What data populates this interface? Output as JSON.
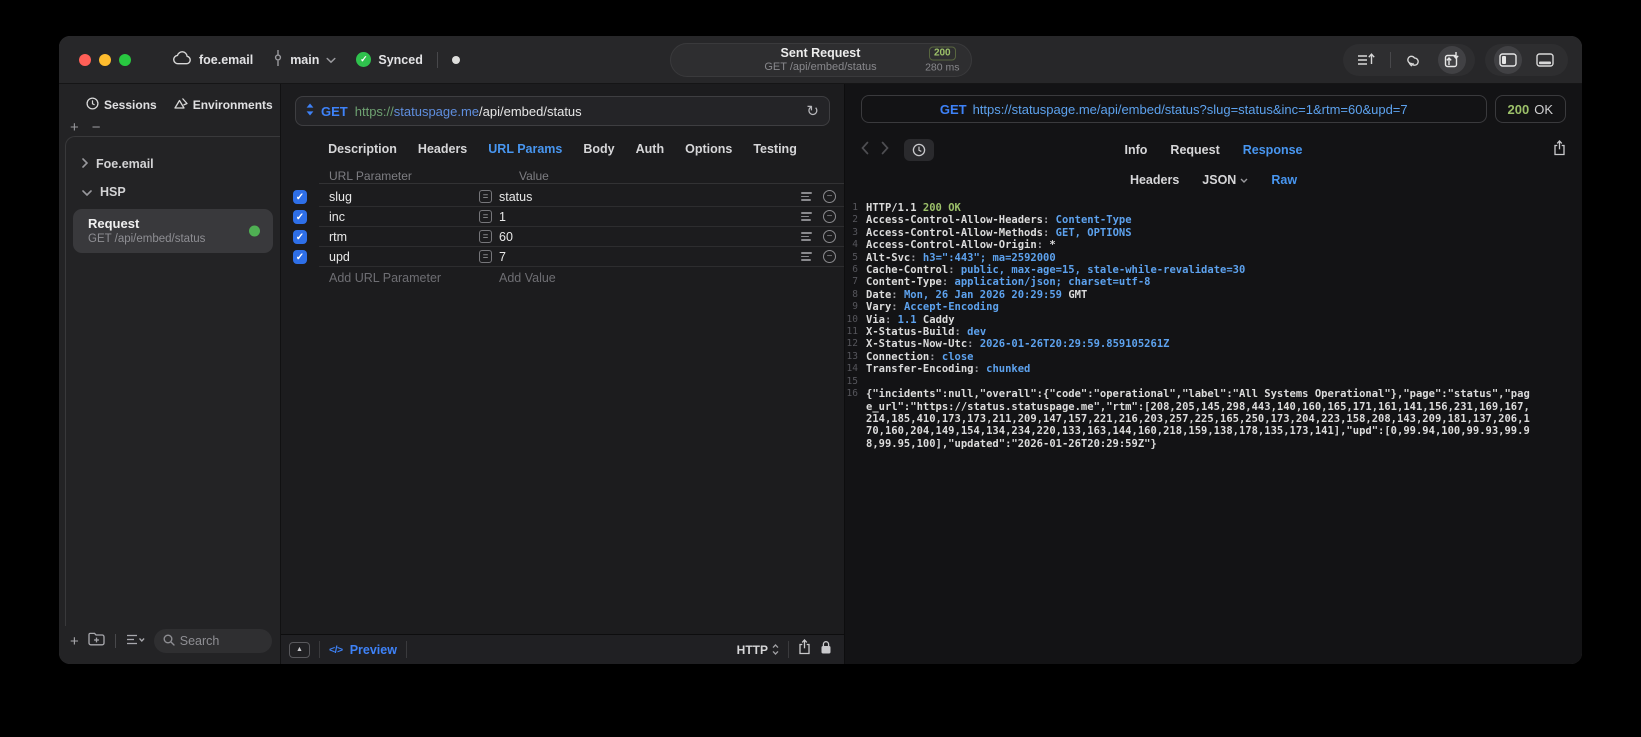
{
  "colors": {
    "accent_blue": "#4896f0",
    "method_blue": "#3e82f8",
    "status_green": "#9cc069",
    "synced_green": "#2fc24d",
    "checkbox_blue": "#2e6fe8",
    "request_dot_green": "#4fb053"
  },
  "titlebar": {
    "project": "foe.email",
    "branch": "main",
    "sync_label": "Synced",
    "center": {
      "title": "Sent Request",
      "subtitle": "GET /api/embed/status",
      "status_code": "200",
      "duration": "280 ms"
    }
  },
  "sidebar": {
    "tabs": [
      {
        "label": "Sessions",
        "icon": "clock-icon"
      },
      {
        "label": "Environments",
        "icon": "environments-icon"
      }
    ],
    "tree": [
      {
        "label": "Foe.email",
        "state": "collapsed"
      },
      {
        "label": "HSP",
        "state": "expanded"
      }
    ],
    "request_item": {
      "title": "Request",
      "subtitle": "GET /api/embed/status",
      "status": "success"
    },
    "search_placeholder": "Search"
  },
  "request_panel": {
    "method": "GET",
    "url": {
      "scheme": "https://",
      "host": "statuspage.me",
      "path": "/api/embed/status"
    },
    "tabs": [
      {
        "label": "Description"
      },
      {
        "label": "Headers"
      },
      {
        "label": "URL Params",
        "active": true
      },
      {
        "label": "Body"
      },
      {
        "label": "Auth"
      },
      {
        "label": "Options"
      },
      {
        "label": "Testing"
      }
    ],
    "params": {
      "columns": [
        "URL Parameter",
        "Value"
      ],
      "rows": [
        {
          "name": "slug",
          "value": "status",
          "enabled": true
        },
        {
          "name": "inc",
          "value": "1",
          "enabled": true
        },
        {
          "name": "rtm",
          "value": "60",
          "enabled": true
        },
        {
          "name": "upd",
          "value": "7",
          "enabled": true
        }
      ],
      "add_name_placeholder": "Add URL Parameter",
      "add_value_placeholder": "Add Value"
    },
    "footer": {
      "code_glyph": "</>",
      "preview_label": "Preview",
      "protocol": "HTTP"
    }
  },
  "response_panel": {
    "method": "GET",
    "url": "https://statuspage.me/api/embed/status?slug=status&inc=1&rtm=60&upd=7",
    "status_code": "200",
    "status_text": "OK",
    "tabs": [
      {
        "label": "Info"
      },
      {
        "label": "Request"
      },
      {
        "label": "Response",
        "active": true
      }
    ],
    "subtabs": [
      {
        "label": "Headers"
      },
      {
        "label": "JSON",
        "dropdown": true
      },
      {
        "label": "Raw",
        "active": true
      }
    ],
    "lines": [
      {
        "n": "1",
        "segs": [
          [
            "HTTP/1.1 ",
            "w"
          ],
          [
            "200 OK",
            "g"
          ]
        ]
      },
      {
        "n": "2",
        "segs": [
          [
            "Access-Control-Allow-Headers",
            "w"
          ],
          [
            ": ",
            "p"
          ],
          [
            "Content-Type",
            "b"
          ]
        ]
      },
      {
        "n": "3",
        "segs": [
          [
            "Access-Control-Allow-Methods",
            "w"
          ],
          [
            ": ",
            "p"
          ],
          [
            "GET, OPTIONS",
            "b"
          ]
        ]
      },
      {
        "n": "4",
        "segs": [
          [
            "Access-Control-Allow-Origin",
            "w"
          ],
          [
            ": ",
            "p"
          ],
          [
            "*",
            "w"
          ]
        ]
      },
      {
        "n": "5",
        "segs": [
          [
            "Alt-Svc",
            "w"
          ],
          [
            ": ",
            "p"
          ],
          [
            "h3=\":443\"; ma=2592000",
            "b"
          ]
        ]
      },
      {
        "n": "6",
        "segs": [
          [
            "Cache-Control",
            "w"
          ],
          [
            ": ",
            "p"
          ],
          [
            "public, max-age=15, stale-while-revalidate=30",
            "b"
          ]
        ]
      },
      {
        "n": "7",
        "segs": [
          [
            "Content-Type",
            "w"
          ],
          [
            ": ",
            "p"
          ],
          [
            "application/json; charset=utf-8",
            "b"
          ]
        ]
      },
      {
        "n": "8",
        "segs": [
          [
            "Date",
            "w"
          ],
          [
            ": ",
            "p"
          ],
          [
            "Mon, 26 Jan 2026 20:29:59 ",
            "b"
          ],
          [
            "GMT",
            "w"
          ]
        ]
      },
      {
        "n": "9",
        "segs": [
          [
            "Vary",
            "w"
          ],
          [
            ": ",
            "p"
          ],
          [
            "Accept-Encoding",
            "b"
          ]
        ]
      },
      {
        "n": "10",
        "segs": [
          [
            "Via",
            "w"
          ],
          [
            ": ",
            "p"
          ],
          [
            "1.1 ",
            "b"
          ],
          [
            "Caddy",
            "w"
          ]
        ]
      },
      {
        "n": "11",
        "segs": [
          [
            "X-Status-Build",
            "w"
          ],
          [
            ": ",
            "p"
          ],
          [
            "dev",
            "b"
          ]
        ]
      },
      {
        "n": "12",
        "segs": [
          [
            "X-Status-Now-Utc",
            "w"
          ],
          [
            ": ",
            "p"
          ],
          [
            "2026-01-26T20:29:59.859105261Z",
            "b"
          ]
        ]
      },
      {
        "n": "13",
        "segs": [
          [
            "Connection",
            "w"
          ],
          [
            ": ",
            "p"
          ],
          [
            "close",
            "b"
          ]
        ]
      },
      {
        "n": "14",
        "segs": [
          [
            "Transfer-Encoding",
            "w"
          ],
          [
            ": ",
            "p"
          ],
          [
            "chunked",
            "b"
          ]
        ]
      },
      {
        "n": "15",
        "segs": []
      },
      {
        "n": "16",
        "segs": [
          [
            "{\"incidents\":null,\"overall\":{\"code\":\"operational\",\"label\":\"All Systems Operational\"},\"page\":\"status\",\"page_url\":\"https://status.statuspage.me\",\"rtm\":[208,205,145,298,443,140,160,165,171,161,141,156,231,169,167,214,185,410,173,173,211,209,147,157,221,216,203,257,225,165,250,173,204,223,158,208,143,209,181,137,206,170,160,204,149,154,134,234,220,133,163,144,160,218,159,138,178,135,173,141],\"upd\":[0,99.94,100,99.93,99.98,99.95,100],\"updated\":\"2026-01-26T20:29:59Z\"}",
            "w"
          ]
        ]
      }
    ]
  }
}
